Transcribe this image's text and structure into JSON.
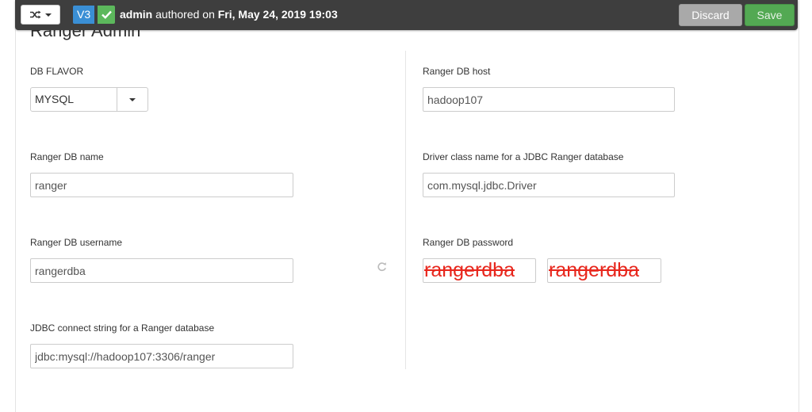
{
  "toolbar": {
    "version": "V3",
    "author": "admin",
    "authored_text": " authored on ",
    "date": "Fri, May 24, 2019 19:03",
    "discard_label": "Discard",
    "save_label": "Save",
    "colors": {
      "bar": "#3e3e3e",
      "version": "#3a8fd5",
      "check": "#5cb85c",
      "save": "#53a953",
      "discard": "#a9a9a9"
    }
  },
  "section": {
    "title": "Ranger Admin"
  },
  "form": {
    "db_flavor": {
      "label": "DB FLAVOR",
      "value": "MYSQL"
    },
    "db_host": {
      "label": "Ranger DB host",
      "value": "hadoop107"
    },
    "db_name": {
      "label": "Ranger DB name",
      "value": "ranger"
    },
    "driver_class": {
      "label": "Driver class name for a JDBC Ranger database",
      "value": "com.mysql.jdbc.Driver"
    },
    "db_username": {
      "label": "Ranger DB username",
      "value": "rangerdba"
    },
    "db_password": {
      "label": "Ranger DB password",
      "value": "rangerdba",
      "confirm_value": "rangerdba",
      "color": "#e8261c"
    },
    "jdbc_string": {
      "label": "JDBC connect string for a Ranger database",
      "value": "jdbc:mysql://hadoop107:3306/ranger"
    }
  },
  "icons": {
    "compare": "shuffle-icon",
    "check": "check-icon",
    "refresh": "refresh-icon",
    "dropdown": "caret-down-icon"
  }
}
